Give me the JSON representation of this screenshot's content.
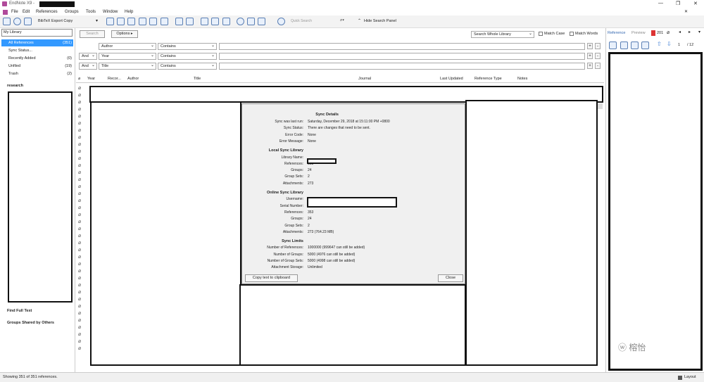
{
  "app": {
    "title": "EndNote X9 -"
  },
  "menu": [
    "File",
    "Edit",
    "References",
    "Groups",
    "Tools",
    "Window",
    "Help"
  ],
  "toolbar": {
    "style": "BibTeX Export Copy",
    "quick_search": "Quick Search",
    "hide_search": "Hide Search Panel"
  },
  "left": {
    "search_box": "My Library",
    "items": [
      {
        "label": "All References",
        "count": "(351)"
      },
      {
        "label": "Sync Status...",
        "count": ""
      },
      {
        "label": "Recently Added",
        "count": "(0)"
      },
      {
        "label": "Unfiled",
        "count": "(19)"
      },
      {
        "label": "Trash",
        "count": "(2)"
      }
    ],
    "group": "research",
    "find_full_text": "Find Full Text",
    "shared": "Groups Shared by Others"
  },
  "search": {
    "search_btn": "Search",
    "options_btn": "Options ▸",
    "scope": "Search Whole Library",
    "match_case": "Match Case",
    "match_words": "Match Words",
    "rows": [
      {
        "bool": "",
        "field": "Author",
        "op": "Contains"
      },
      {
        "bool": "And",
        "field": "Year",
        "op": "Contains"
      },
      {
        "bool": "And",
        "field": "Title",
        "op": "Contains"
      }
    ]
  },
  "columns": [
    "Year",
    "Recor...",
    "Author",
    "Title",
    "Journal",
    "Last Updated",
    "Reference Type",
    "Notes"
  ],
  "dialog": {
    "h1": "Sync Details",
    "details": [
      [
        "Sync was last run:",
        "Saturday, December 29, 2018 at 15:11:00 PM +0800"
      ],
      [
        "Sync Status:",
        "There are changes that need to be sent."
      ],
      [
        "Error Code:",
        "None"
      ],
      [
        "Error Message:",
        "None"
      ]
    ],
    "h2": "Local Sync Library",
    "local": [
      [
        "Library Name:",
        ""
      ],
      [
        "References:",
        "353"
      ],
      [
        "Groups:",
        "24"
      ],
      [
        "Group Sets:",
        "2"
      ],
      [
        "Attachments:",
        "273"
      ]
    ],
    "h3": "Online Sync Library",
    "online": [
      [
        "Username:",
        ""
      ],
      [
        "Serial Number:",
        ""
      ],
      [
        "References:",
        "353"
      ],
      [
        "Groups:",
        "24"
      ],
      [
        "Group Sets:",
        "2"
      ],
      [
        "Attachments:",
        "273 (764.23 MB)"
      ]
    ],
    "h4": "Sync Limits",
    "limits": [
      [
        "Number of References:",
        "1000000 (999647 can still be added)"
      ],
      [
        "Number of Groups:",
        "5000 (4976 can still be added)"
      ],
      [
        "Number of Group Sets:",
        "5000 (4998 can still be added)"
      ],
      [
        "Attachment Storage:",
        "Unlimited"
      ]
    ],
    "copy_btn": "Copy text to clipboard",
    "close_btn": "Close"
  },
  "right": {
    "tab_ref": "Reference",
    "tab_preview": "Preview",
    "pdf_tab": "201",
    "page": "1",
    "page_total": "/ 12"
  },
  "status": {
    "text": "Showing 351 of 351 references.",
    "layout": "Layout"
  },
  "watermark": "榕怡"
}
